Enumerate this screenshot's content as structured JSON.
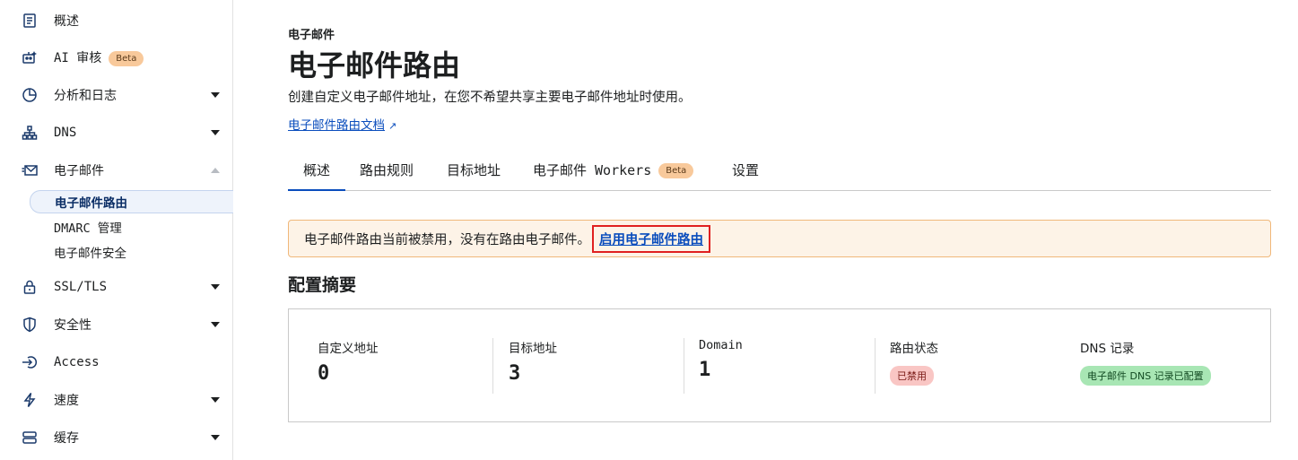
{
  "sidebar": {
    "items": [
      {
        "label": "概述",
        "icon": "document-icon"
      },
      {
        "label": "AI 审核",
        "badge": "Beta",
        "icon": "robot-icon"
      },
      {
        "label": "分析和日志",
        "icon": "pie-chart-icon"
      },
      {
        "label": "DNS",
        "icon": "network-icon"
      },
      {
        "label": "电子邮件",
        "icon": "email-icon"
      },
      {
        "label": "SSL/TLS",
        "icon": "lock-icon"
      },
      {
        "label": "安全性",
        "icon": "shield-icon"
      },
      {
        "label": "Access",
        "icon": "access-icon"
      },
      {
        "label": "速度",
        "icon": "lightning-icon"
      },
      {
        "label": "缓存",
        "icon": "storage-icon"
      }
    ],
    "email_sub": [
      {
        "label": "电子邮件路由"
      },
      {
        "label": "DMARC 管理"
      },
      {
        "label": "电子邮件安全"
      }
    ]
  },
  "header": {
    "breadcrumb": "电子邮件",
    "title": "电子邮件路由",
    "description": "创建自定义电子邮件地址，在您不希望共享主要电子邮件地址时使用。",
    "doc_link": "电子邮件路由文档"
  },
  "tabs": [
    {
      "label": "概述"
    },
    {
      "label": "路由规则"
    },
    {
      "label": "目标地址"
    },
    {
      "label": "电子邮件 Workers",
      "badge": "Beta"
    },
    {
      "label": "设置"
    }
  ],
  "alert": {
    "text": "电子邮件路由当前被禁用，没有在路由电子邮件。",
    "link": "启用电子邮件路由"
  },
  "summary": {
    "title": "配置摘要",
    "columns": [
      {
        "label": "自定义地址",
        "value": "0"
      },
      {
        "label": "目标地址",
        "value": "3"
      },
      {
        "label": "Domain",
        "value": "1"
      },
      {
        "label": "路由状态",
        "status": "已禁用"
      },
      {
        "label": "DNS 记录",
        "status": "电子邮件 DNS 记录已配置"
      }
    ]
  },
  "colors": {
    "accent": "#0a4dbd",
    "alert_bg": "#fdf3e7",
    "alert_border": "#f0b87a",
    "status_disabled": "#f9c6c4",
    "status_ok": "#a8e6b4"
  }
}
